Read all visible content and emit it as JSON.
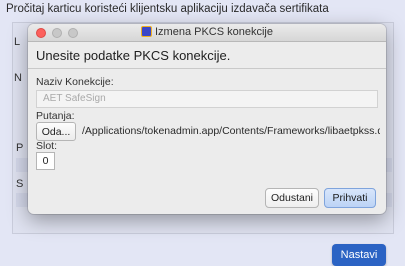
{
  "background": {
    "title": "Pročitaj karticu koristeći klijentsku aplikaciju izdavača sertifikata",
    "fragments": [
      "L",
      "N",
      "P",
      "S"
    ],
    "next_button": "Nastavi"
  },
  "dialog": {
    "window_title": "Izmena PKCS konekcije",
    "heading": "Unesite podatke PKCS konekcije.",
    "name_label": "Naziv Konekcije:",
    "name_value": "AET SafeSign",
    "path_label": "Putanja:",
    "browse_button": "Oda...",
    "path_value": "/Applications/tokenadmin.app/Contents/Frameworks/libaetpkss.d...",
    "slot_label": "Slot:",
    "slot_value": "0",
    "cancel_button": "Odustani",
    "ok_button": "Prihvati"
  },
  "colors": {
    "accent": "#2b63c4",
    "close_light": "#fc605c"
  }
}
